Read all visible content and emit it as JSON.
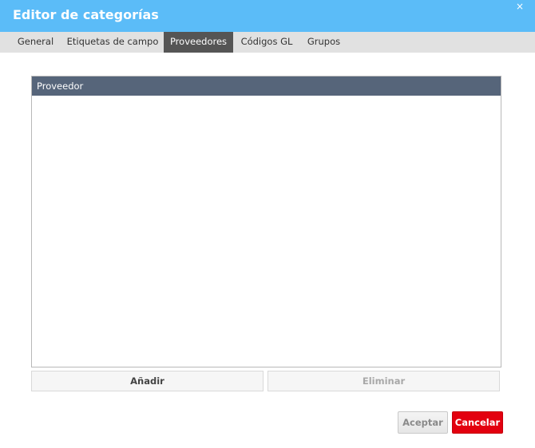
{
  "dialog": {
    "title": "Editor de categorías",
    "close_glyph": "×"
  },
  "tabs": [
    {
      "label": "General",
      "active": false
    },
    {
      "label": "Etiquetas de campo",
      "active": false
    },
    {
      "label": "Proveedores",
      "active": true
    },
    {
      "label": "Códigos GL",
      "active": false
    },
    {
      "label": "Grupos",
      "active": false
    }
  ],
  "supplier_list": {
    "header": "Proveedor",
    "rows": []
  },
  "actions": {
    "add_label": "Añadir",
    "delete_label": "Eliminar",
    "delete_enabled": false
  },
  "footer": {
    "accept_label": "Aceptar",
    "cancel_label": "Cancelar"
  },
  "colors": {
    "titlebar": "#5bbcf8",
    "active_tab": "#555555",
    "list_header": "#56657a",
    "cancel": "#e3000f"
  }
}
